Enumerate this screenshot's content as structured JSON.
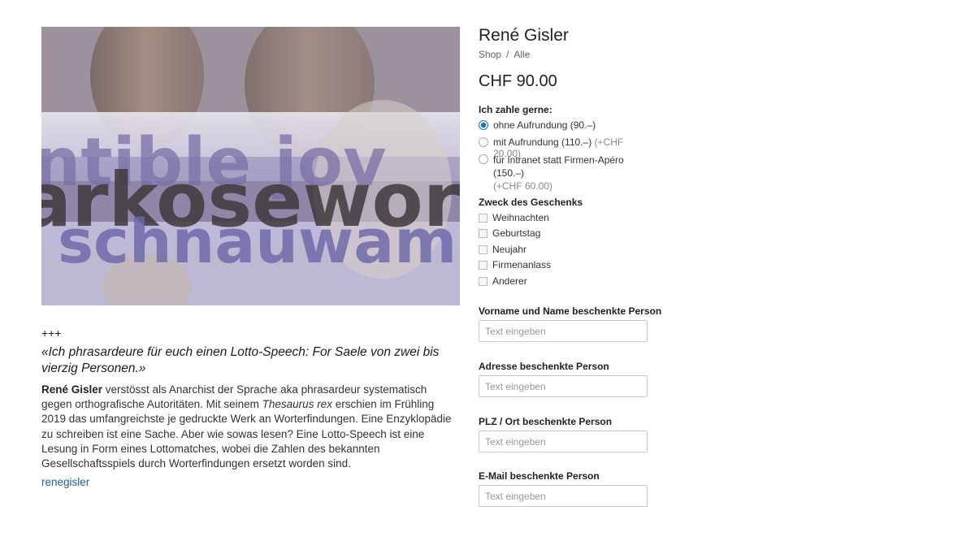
{
  "product": {
    "title": "René Gisler",
    "breadcrumb": {
      "shop": "Shop",
      "separator": "/",
      "category": "Alle"
    },
    "price": "CHF 90.00",
    "image_words": [
      "ntible jov",
      "arkosewors",
      "schnauwam"
    ]
  },
  "payment": {
    "label": "Ich zahle gerne:",
    "options": [
      {
        "text": "ohne Aufrundung (90.–)",
        "extra": "",
        "checked": true
      },
      {
        "text": "mit Aufrundung (110.–)",
        "extra": "(+CHF 20.00)",
        "checked": false
      },
      {
        "text": "für Intranet statt Firmen-Apéro (150.–)",
        "extra": "(+CHF 60.00)",
        "checked": false
      }
    ]
  },
  "purpose": {
    "label": "Zweck des Geschenks",
    "options": [
      "Weihnachten",
      "Geburtstag",
      "Neujahr",
      "Firmenanlass",
      "Anderer"
    ]
  },
  "fields": [
    {
      "label": "Vorname und Name beschenkte Person",
      "placeholder": "Text eingeben"
    },
    {
      "label": "Adresse beschenkte Person",
      "placeholder": "Text eingeben"
    },
    {
      "label": "PLZ / Ort beschenkte Person",
      "placeholder": "Text eingeben"
    },
    {
      "label": "E-Mail beschenkte Person",
      "placeholder": "Text eingeben"
    }
  ],
  "description": {
    "marker": "+++",
    "quote": "«Ich phrasardeure für euch einen Lotto-Speech: For Saele von zwei bis vierzig Personen.»",
    "author": "René Gisler",
    "text_1": " verstösst als Anarchist der Sprache aka phrasardeur systematisch gegen orthografische Autoritäten. Mit seinem ",
    "book": "Thesaurus rex",
    "text_2": " erschien im Frühling 2019 das umfangreichste je gedruckte Werk an Worterfindungen. Eine Enzyklopädie zu schreiben ist eine Sache. Aber wie sowas lesen? Eine Lotto-Speech ist eine Lesung in Form eines Lottomatches, wobei die Zahlen des bekannten Gesellschaftsspiels durch Worterfindungen ersetzt worden sind.",
    "link": "renegisler"
  },
  "colors": {
    "accent": "#1b76c8",
    "link": "#1f5fa9"
  }
}
